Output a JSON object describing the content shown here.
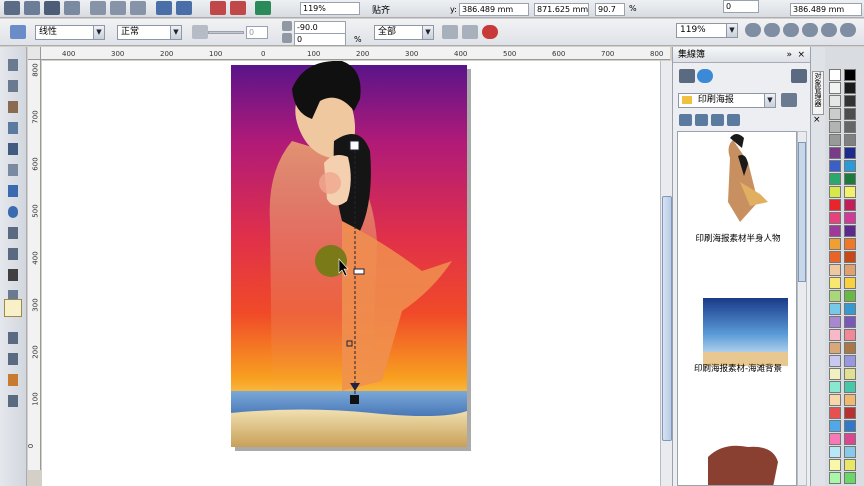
{
  "toolbar": {
    "zoom_top": "119%",
    "snap_label": "贴齐",
    "y_label": "y:",
    "y_value": "386.489 mm",
    "height_value": "871.625 mm",
    "scale_value": "90.7",
    "percent_sign": "%",
    "rot_value": "0",
    "extra_zoom": "119%",
    "coord_value": "386.489 mm"
  },
  "propbar": {
    "blend_mode": "线性",
    "blend_type": "正常",
    "slider_value": "0",
    "angle_value": "-90.0",
    "offset_value": "0",
    "pct_sign": "%",
    "scope": "全部",
    "zoom": "119%"
  },
  "ruler": {
    "h_ticks": [
      "400",
      "300",
      "200",
      "100",
      "0",
      "100",
      "200",
      "300",
      "400",
      "500",
      "600",
      "700",
      "800"
    ],
    "v_ticks": [
      "800",
      "700",
      "600",
      "500",
      "400",
      "300",
      "200",
      "100",
      "0"
    ]
  },
  "docker": {
    "title": "集線簿",
    "folder": "印刷海报",
    "items": [
      {
        "label": "印刷海报素材半身人物"
      },
      {
        "label": "印刷海报素材-海滩背景"
      }
    ],
    "side_tabs": "对象管理器"
  },
  "palette_colors": [
    [
      "#ffffff",
      "#000000"
    ],
    [
      "#f2f2f2",
      "#1a1a1a"
    ],
    [
      "#e6e6e6",
      "#333333"
    ],
    [
      "#cccccc",
      "#4d4d4d"
    ],
    [
      "#b3b3b3",
      "#666666"
    ],
    [
      "#999999",
      "#808080"
    ],
    [
      "#7a3a8a",
      "#1e2a8c"
    ],
    [
      "#3a5fc8",
      "#2a9bd8"
    ],
    [
      "#2ca86c",
      "#1d7a3c"
    ],
    [
      "#d7e84a",
      "#f4f06a"
    ],
    [
      "#e8262a",
      "#c21f5a"
    ],
    [
      "#e8427c",
      "#d23a9a"
    ],
    [
      "#9e3a9a",
      "#5c2a8c"
    ],
    [
      "#f0a030",
      "#f07828"
    ],
    [
      "#e86428",
      "#c84818"
    ],
    [
      "#f0c8a0",
      "#e0a070"
    ],
    [
      "#f8e870",
      "#f8d040"
    ],
    [
      "#a8d878",
      "#68b848"
    ],
    [
      "#78c8e8",
      "#3898d0"
    ],
    [
      "#a888d0",
      "#7858b8"
    ],
    [
      "#f8b8c8",
      "#f08898"
    ],
    [
      "#d8a878",
      "#a87848"
    ],
    [
      "#c8c8f0",
      "#9898e0"
    ],
    [
      "#f0f0c0",
      "#e0e090"
    ],
    [
      "#88e8d0",
      "#48c8a8"
    ],
    [
      "#f8d8a8",
      "#f0b870"
    ],
    [
      "#e85050",
      "#b83030"
    ],
    [
      "#50a8e8",
      "#3078c8"
    ],
    [
      "#f878b8",
      "#d84890"
    ],
    [
      "#b8e8f8",
      "#88c8e8"
    ],
    [
      "#f8f8a8",
      "#e8e868"
    ],
    [
      "#a8f8a8",
      "#68d868"
    ]
  ]
}
